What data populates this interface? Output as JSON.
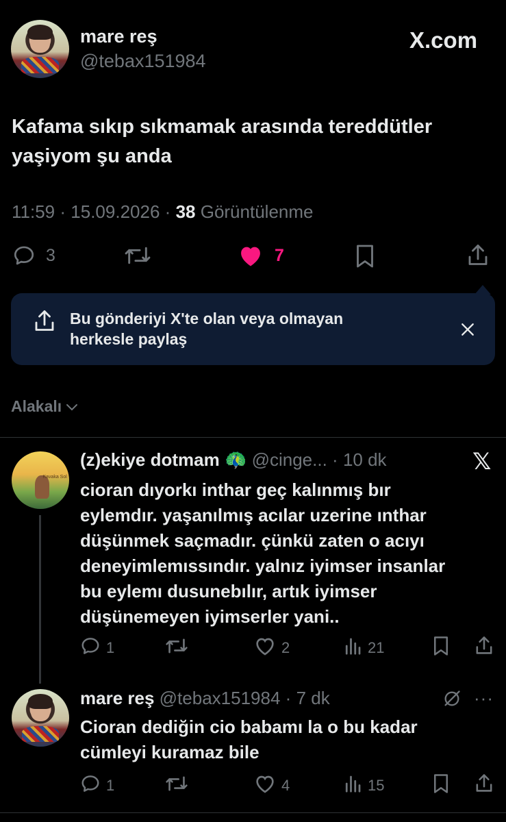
{
  "main_post": {
    "display_name": "mare reş",
    "handle": "@tebax151984",
    "site_logo": "X.com",
    "text_line1": "Kafama sıkıp sıkmamak arasında tereddütler",
    "text_line2": "yaşiyom şu anda",
    "time": "11:59",
    "sep1": "·",
    "date": "15.09.2026",
    "sep2": "·",
    "views_count": "38",
    "views_label": "Görüntülenme",
    "replies": "3",
    "likes": "7",
    "icons": [
      "reply-icon",
      "retweet-icon",
      "like-icon-filled",
      "bookmark-icon",
      "share-icon"
    ]
  },
  "share_banner": {
    "line1": "Bu gönderiyi X'te olan veya olmayan",
    "line2": "herkesle paylaş",
    "icons": [
      "share-icon",
      "close-icon"
    ]
  },
  "sort": {
    "label": "Alakalı",
    "icon": "chevron-down-icon"
  },
  "replies": [
    {
      "display_name": "(z)ekiye dotmam",
      "emoji": "🦚",
      "handle": "@cinge...",
      "sep": "·",
      "time": "10 dk",
      "lines": [
        "cioran dıyorkı inthar geç kalınmış bır",
        "eylemdır. yaşanılmış acılar uzerine ınthar",
        "düşünmek saçmadır. çünkü zaten o acıyı",
        "deneyimlemıssındır. yalnız iyimser insanlar",
        "bu eylemı dusunebılır, artık iyimser",
        "düşünemeyen iyimserler yani.."
      ],
      "replies": "1",
      "likes": "2",
      "views": "21",
      "avatar_text": "Kavaka Sol"
    },
    {
      "display_name": "mare reş",
      "handle": "@tebax151984",
      "sep": "·",
      "time": "7 dk",
      "lines": [
        "Cioran dediğin cio babamı la o bu kadar",
        "cümleyi kuramaz bile"
      ],
      "replies": "1",
      "likes": "4",
      "views": "15"
    }
  ],
  "colors": {
    "background": "#000000",
    "text": "#e7e9ea",
    "secondary": "#71767b",
    "like_pink": "#f91880",
    "banner_bg": "#0f1c33",
    "divider": "#2f3336"
  }
}
